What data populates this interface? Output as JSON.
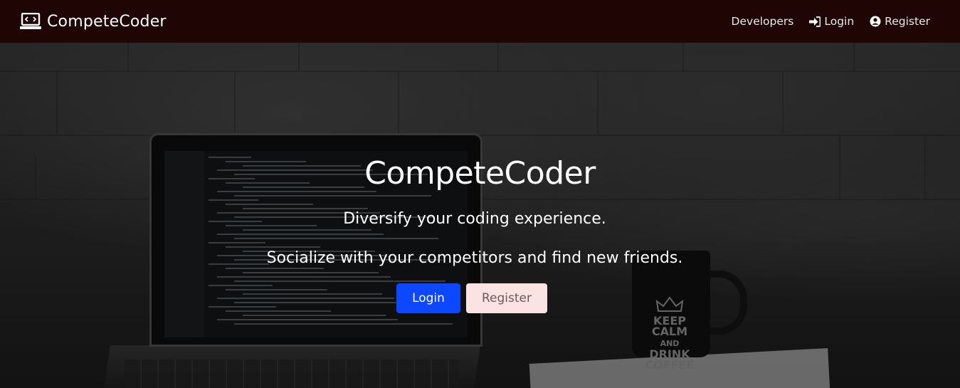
{
  "navbar": {
    "brand": "CompeteCoder",
    "links": [
      {
        "label": "Developers",
        "icon": "none"
      },
      {
        "label": "Login",
        "icon": "sign-in-icon"
      },
      {
        "label": "Register",
        "icon": "user-circle-icon"
      }
    ]
  },
  "hero": {
    "title": "CompeteCoder",
    "subtitle_1": "Diversify your coding experience.",
    "subtitle_2": "Socialize with your competitors and find new friends.",
    "login_button": "Login",
    "register_button": "Register",
    "mug_text": "KEEP CALM AND DRINK COFFEE"
  },
  "colors": {
    "navbar_bg": "#200505",
    "login_button": "#0d47ff",
    "register_button": "#fbe3e3"
  }
}
